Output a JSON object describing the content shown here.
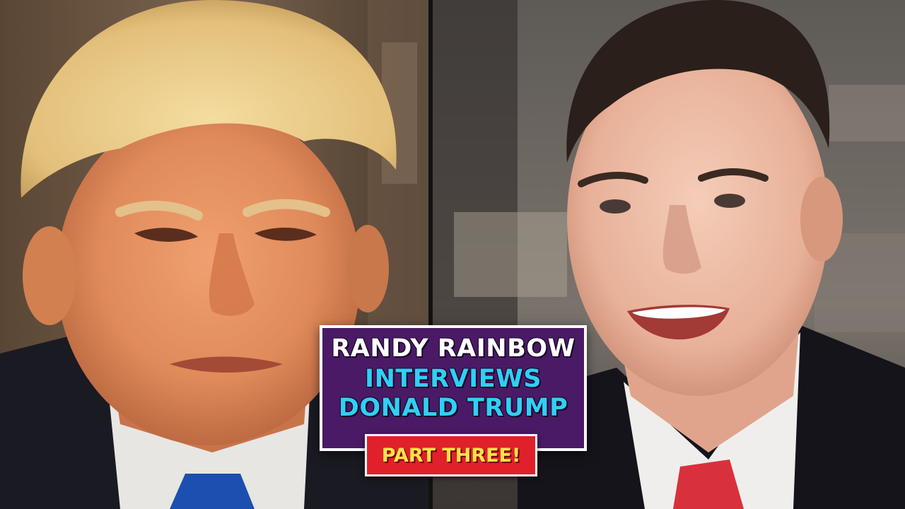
{
  "title_card": {
    "line1": "RANDY RAINBOW",
    "line2": "INTERVIEWS",
    "line3": "DONALD TRUMP",
    "badge": "PART THREE!"
  },
  "colors": {
    "card_background": "#4a1a66",
    "card_border": "#ffffff",
    "line1_text": "#ffffff",
    "accent_text": "#2fd0f5",
    "badge_background": "#e0202a",
    "badge_text": "#ffe34a",
    "left_tie": "#1c4fb0",
    "right_tie": "#d8313c"
  }
}
